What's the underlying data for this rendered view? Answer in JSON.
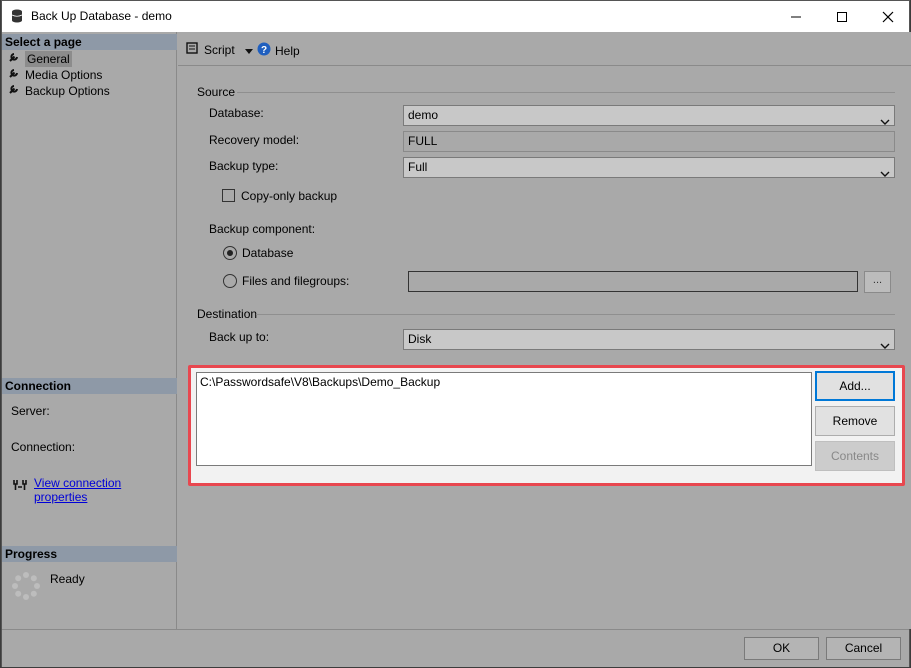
{
  "window": {
    "title": "Back Up Database - demo",
    "controls": [
      "minimize-icon",
      "maximize-icon",
      "close-icon"
    ]
  },
  "left_pane": {
    "select_page_header": "Select a page",
    "pages": [
      {
        "label": "General",
        "selected": true
      },
      {
        "label": "Media Options",
        "selected": false
      },
      {
        "label": "Backup Options",
        "selected": false
      }
    ],
    "connection_header": "Connection",
    "server_label": "Server:",
    "connection_label": "Connection:",
    "view_connection_link": "View connection properties",
    "progress_header": "Progress",
    "progress_status": "Ready"
  },
  "toolbar": {
    "script_label": "Script",
    "help_label": "Help"
  },
  "source": {
    "group_label": "Source",
    "database_label": "Database:",
    "database_value": "demo",
    "recovery_model_label": "Recovery model:",
    "recovery_model_value": "FULL",
    "backup_type_label": "Backup type:",
    "backup_type_value": "Full",
    "copy_only_label": "Copy-only backup",
    "copy_only_checked": false,
    "backup_component_label": "Backup component:",
    "component_database_label": "Database",
    "component_files_label": "Files and filegroups:",
    "selected_component": "Database",
    "ellipsis_label": "..."
  },
  "destination": {
    "group_label": "Destination",
    "back_up_to_label": "Back up to:",
    "back_up_to_value": "Disk",
    "paths": [
      "C:\\Passwordsafe\\V8\\Backups\\Demo_Backup"
    ],
    "add_label": "Add...",
    "remove_label": "Remove",
    "contents_label": "Contents"
  },
  "footer": {
    "ok_label": "OK",
    "cancel_label": "Cancel"
  },
  "colors": {
    "highlight_border": "#e8474f",
    "section_header": "#8e99a7",
    "link": "#0000d8"
  }
}
